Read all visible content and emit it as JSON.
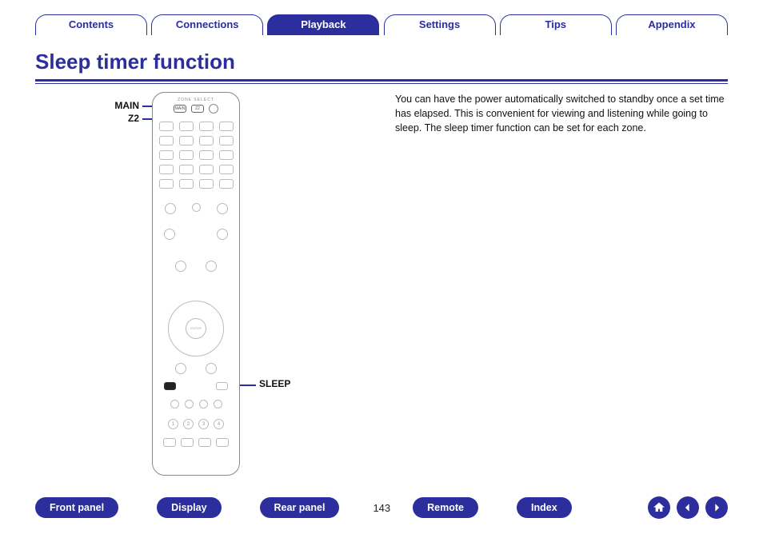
{
  "tabs": {
    "contents": "Contents",
    "connections": "Connections",
    "playback": "Playback",
    "settings": "Settings",
    "tips": "Tips",
    "appendix": "Appendix"
  },
  "page_title": "Sleep timer function",
  "callouts": {
    "main": "MAIN",
    "z2": "Z2",
    "sleep": "SLEEP"
  },
  "body_text": "You can have the power automatically switched to standby once a set time has elapsed. This is convenient for viewing and listening while going to sleep. The sleep timer function can be set for each zone.",
  "remote": {
    "zone_select_label": "ZONE SELECT",
    "zone_buttons": [
      "MAIN",
      "Z2"
    ],
    "dpad_center": "ENTER",
    "smart_select_numbers": [
      "1",
      "2",
      "3",
      "4"
    ]
  },
  "bottom_nav": {
    "front_panel": "Front panel",
    "display": "Display",
    "rear_panel": "Rear panel",
    "remote": "Remote",
    "index": "Index"
  },
  "page_number": "143",
  "icons": {
    "home": "home-icon",
    "prev": "arrow-left-icon",
    "next": "arrow-right-icon"
  }
}
